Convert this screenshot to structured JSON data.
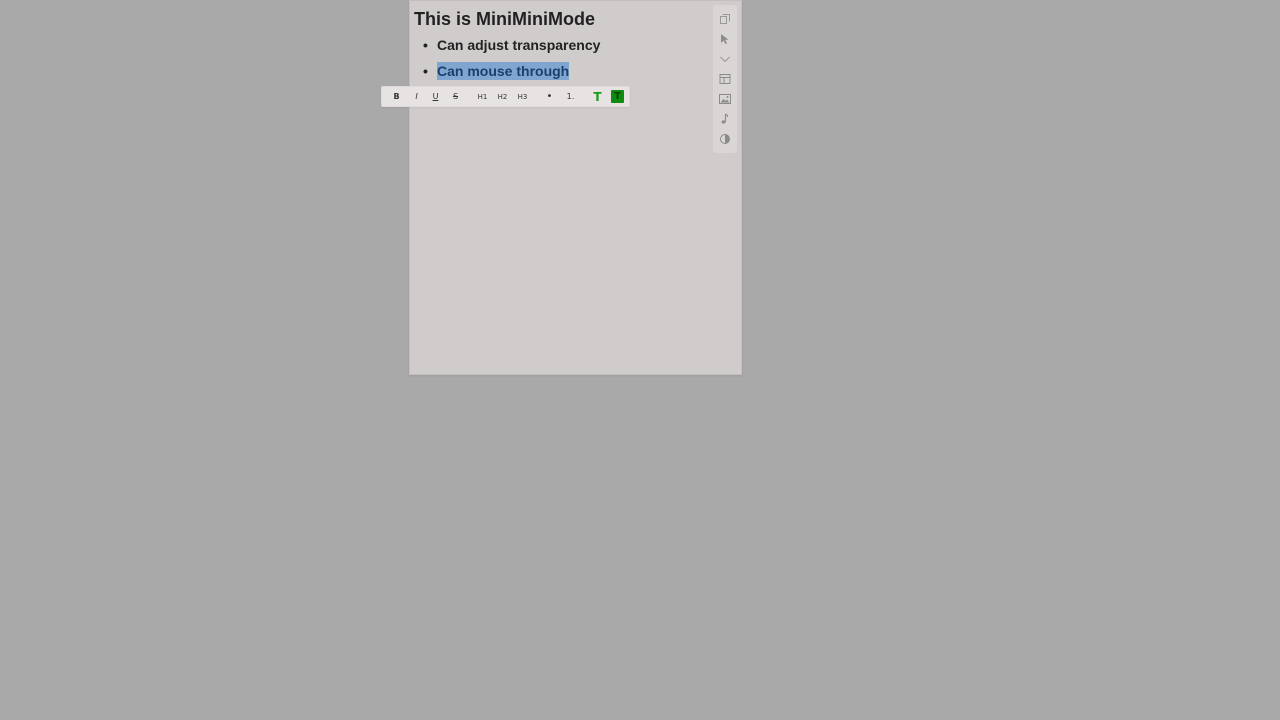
{
  "note": {
    "title": "This is MiniMiniMode",
    "items": [
      {
        "label": "Can adjust transparency",
        "bullet": "•"
      },
      {
        "label": "Can mouse through",
        "bullet": "•"
      }
    ]
  },
  "side_toolbar": {
    "icons": [
      "window-icon",
      "cursor-icon",
      "chevron-down-icon",
      "layout-icon",
      "image-icon",
      "music-note-icon",
      "contrast-icon"
    ]
  },
  "format_toolbar": {
    "bold": "B",
    "italic": "I",
    "underline": "U",
    "strike": "S",
    "h1": "H1",
    "h2": "H2",
    "h3": "H3",
    "bullet_list": "•",
    "numbered_list": "1.",
    "text_color": "T",
    "highlight": "T"
  },
  "colors": {
    "background": "#a9a9a9",
    "note_background": "#cfcccb",
    "selection": "#7fa6cf",
    "text_color_accent": "#1a9a1a",
    "highlight_accent": "#0f8b0f"
  }
}
